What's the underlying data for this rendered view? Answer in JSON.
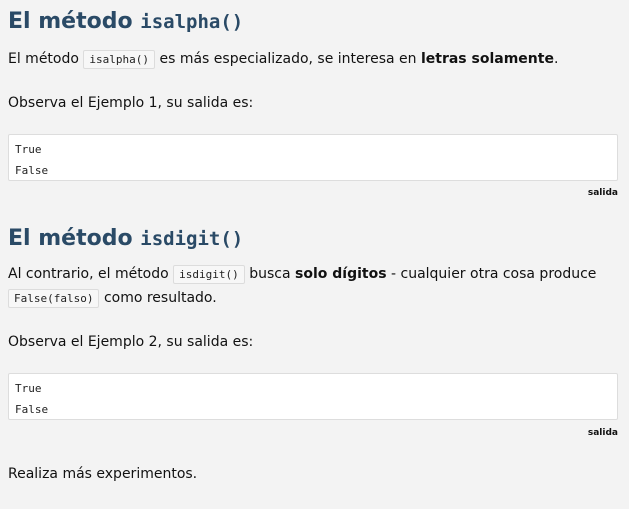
{
  "section1": {
    "heading_prefix": "El método",
    "heading_code": "isalpha()",
    "para1": {
      "before": "El método",
      "code": "isalpha()",
      "middle": "es más especializado, se interesa en",
      "strong": "letras solamente",
      "after": "."
    },
    "para2": "Observa el Ejemplo 1, su salida es:",
    "output_lines": [
      "True",
      "False"
    ],
    "caption": "salida"
  },
  "section2": {
    "heading_prefix": "El método",
    "heading_code": "isdigit()",
    "para1": {
      "before": "Al contrario, el método",
      "code": "isdigit()",
      "middle": "busca",
      "strong": "solo dígitos",
      "after": "- cualquier otra cosa produce",
      "code2": "False(falso)",
      "end": "como resultado."
    },
    "para2": "Observa el Ejemplo 2, su salida es:",
    "output_lines": [
      "True",
      "False"
    ],
    "caption": "salida"
  },
  "closing": "Realiza más experimentos."
}
